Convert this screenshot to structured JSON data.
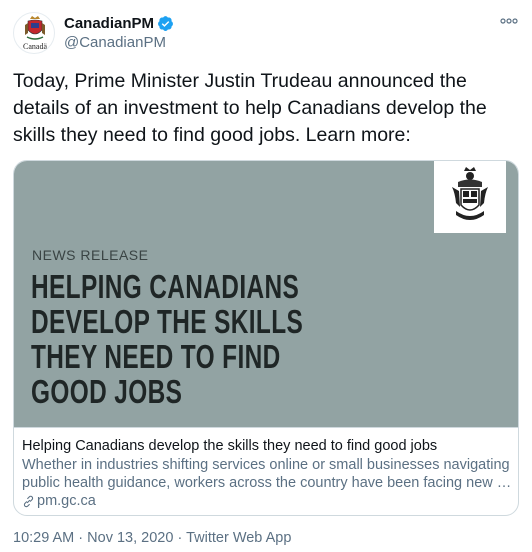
{
  "author": {
    "display_name": "CanadianPM",
    "handle": "@CanadianPM",
    "avatar_wordmark": "Canadä"
  },
  "tweet": {
    "text": "Today, Prime Minister Justin Trudeau announced the details of an investment to help Canadians develop the skills they need to find good jobs. Learn more:"
  },
  "card": {
    "label": "NEWS RELEASE",
    "headline_lines": [
      "HELPING CANADIANS",
      "DEVELOP THE SKILLS",
      "THEY NEED TO FIND",
      "GOOD JOBS"
    ],
    "title": "Helping Canadians develop the skills they need to find good jobs",
    "description": "Whether in industries shifting services online or small businesses navigating public health guidance, workers across the country have been facing new …",
    "domain": "pm.gc.ca",
    "image_bg_color": "#92a3a3"
  },
  "meta": {
    "time": "10:29 AM",
    "separator": "·",
    "date": "Nov 13, 2020",
    "source": "Twitter Web App"
  },
  "colors": {
    "verified_badge": "#1da1f2",
    "secondary_text": "#5b7083"
  }
}
